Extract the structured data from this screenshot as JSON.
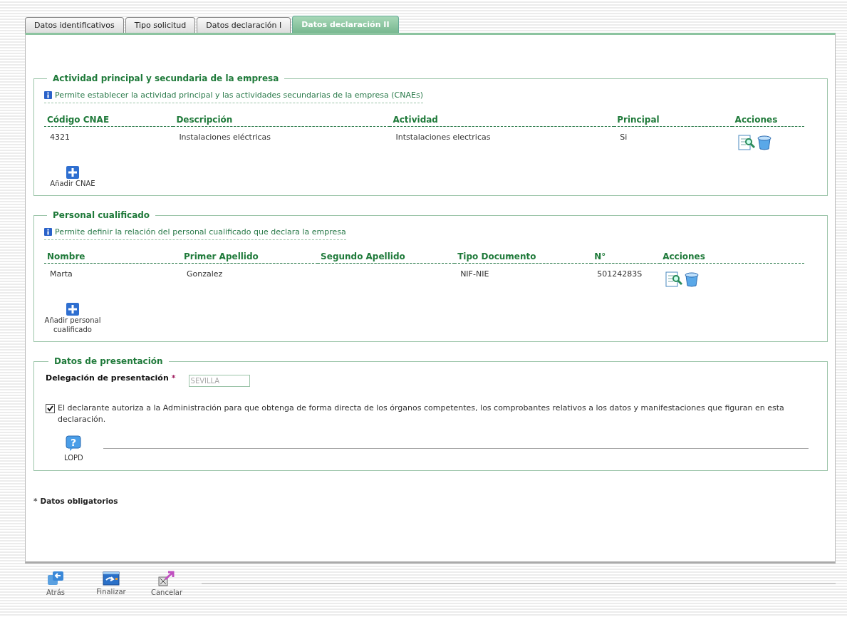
{
  "tabs": [
    {
      "label": "Datos identificativos",
      "selected": false
    },
    {
      "label": "Tipo solicitud",
      "selected": false
    },
    {
      "label": "Datos declaración I",
      "selected": false
    },
    {
      "label": "Datos declaración II",
      "selected": true
    }
  ],
  "activity": {
    "legend": "Actividad principal y secundaria de la empresa",
    "info": "Permite establecer la actividad principal y las actividades secundarias de la empresa (CNAEs)",
    "columns": [
      "Código CNAE",
      "Descripción",
      "Actividad",
      "Principal",
      "Acciones"
    ],
    "rows": [
      {
        "cells": [
          "4321",
          "Instalaciones eléctricas",
          "Intstalaciones electricas",
          "Si"
        ]
      }
    ],
    "add_label": "Añadir CNAE"
  },
  "personal": {
    "legend": "Personal cualificado",
    "info": "Permite definir la relación del personal cualificado que declara la empresa",
    "columns": [
      "Nombre",
      "Primer Apellido",
      "Segundo Apellido",
      "Tipo Documento",
      "N°",
      "Acciones"
    ],
    "rows": [
      {
        "cells": [
          "Marta",
          "Gonzalez",
          "",
          "NIF-NIE",
          "50124283S"
        ]
      }
    ],
    "add_label": "Añadir personal cualificado"
  },
  "presentation": {
    "legend": "Datos de presentación",
    "delegation_label": "Delegación de presentación",
    "required_mark": "*",
    "delegation_value": "SEVILLA",
    "authorization": {
      "checked": true,
      "text": "El declarante autoriza a la Administración para que obtenga de forma directa de los órganos competentes, los comprobantes relativos a los datos y manifestaciones que figuran en esta declaración."
    },
    "lopd_icon": "?",
    "lopd_label": "LOPD"
  },
  "required_note": {
    "mark": "*",
    "text": "Datos obligatorios"
  },
  "footer_buttons": [
    {
      "kind": "back",
      "label": "Atrás"
    },
    {
      "kind": "finish",
      "label": "Finalizar"
    },
    {
      "kind": "cancel",
      "label": "Cancelar"
    }
  ]
}
